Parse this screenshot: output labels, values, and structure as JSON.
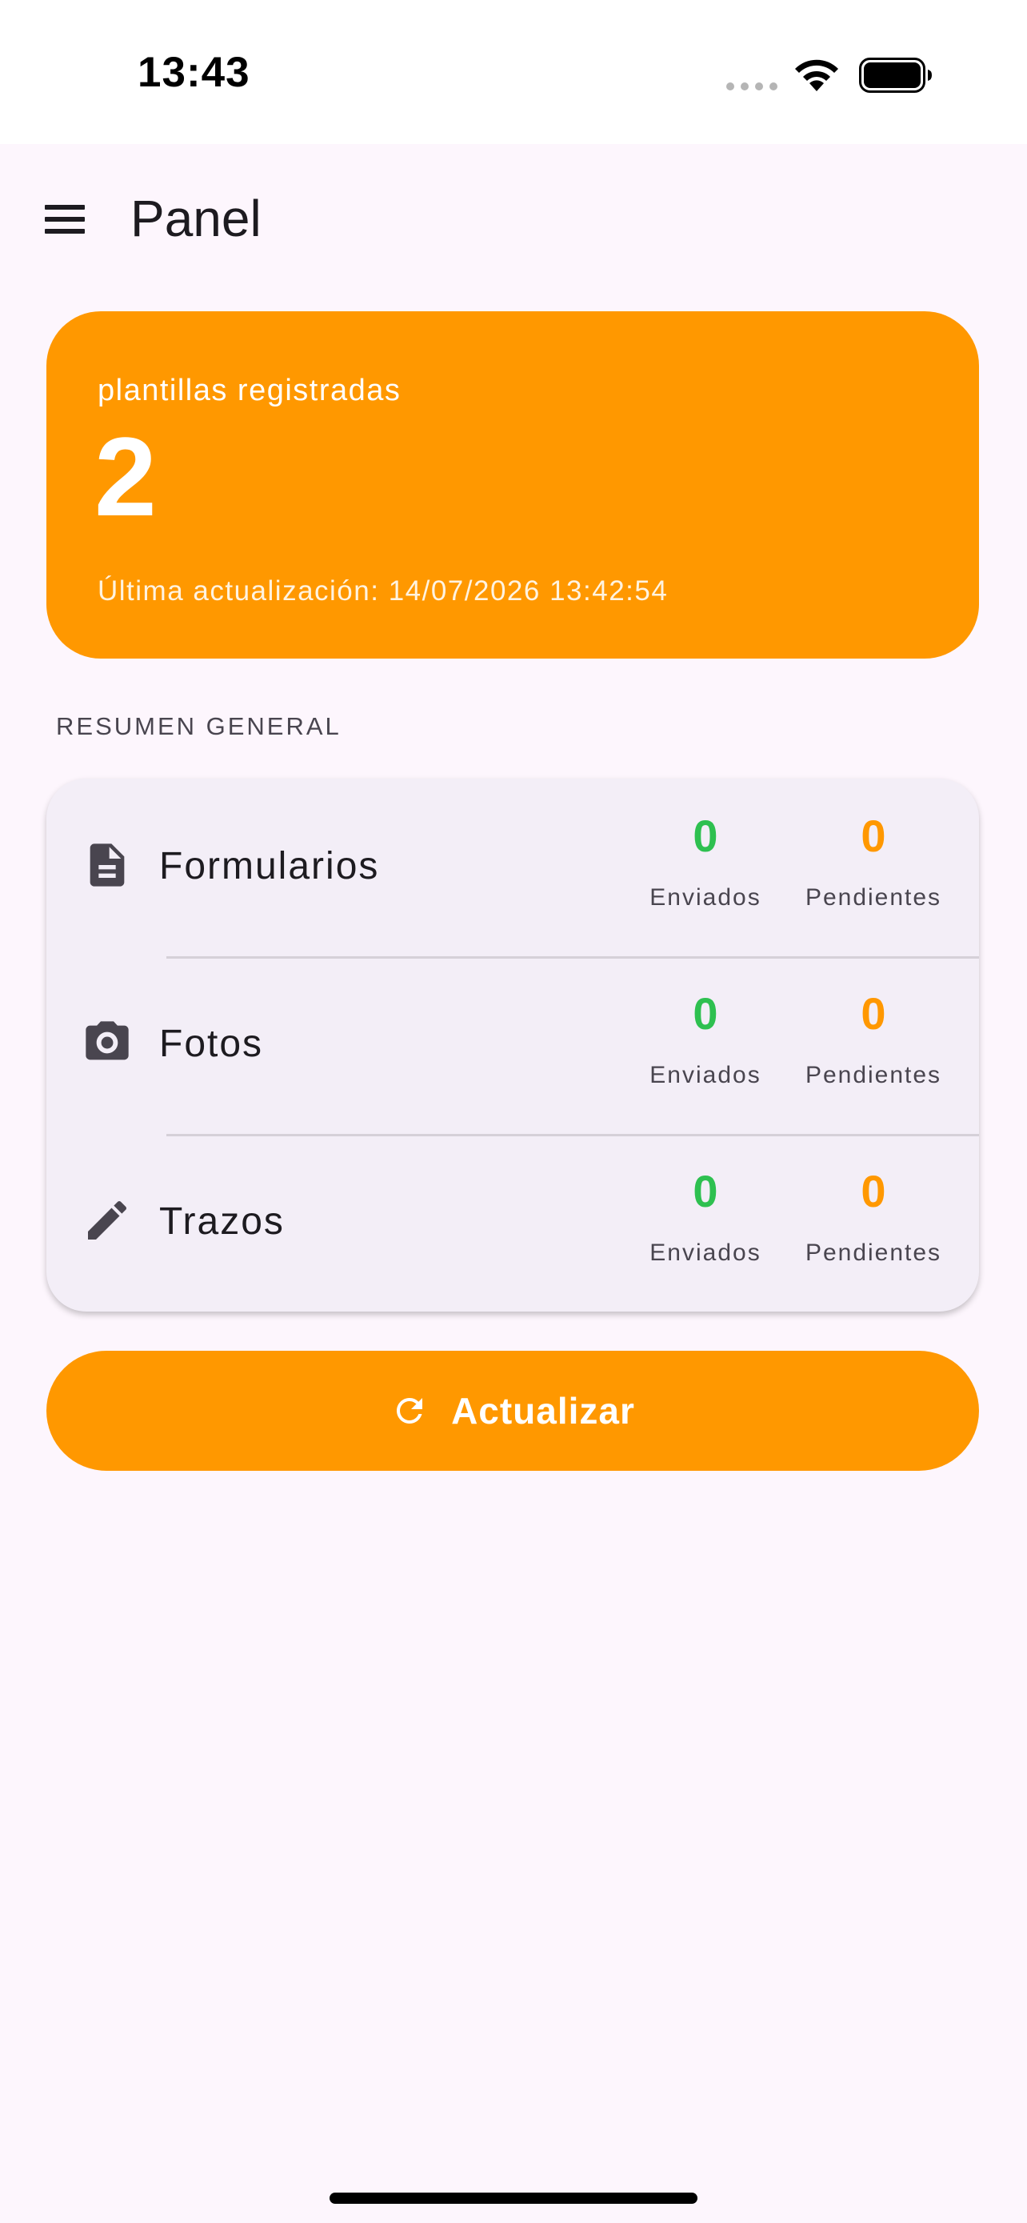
{
  "status_bar": {
    "time": "13:43",
    "icons": [
      "signal-icon",
      "wifi-icon",
      "battery-icon"
    ]
  },
  "app_bar": {
    "menu_icon": "menu-icon",
    "title": "Panel"
  },
  "hero": {
    "caption": "plantillas registradas",
    "count": "2",
    "updated": "Última actualización: 14/07/2026 13:42:54",
    "color": "#ff9800"
  },
  "summary": {
    "section_title": "RESUMEN GENERAL",
    "rows": [
      {
        "icon": "document-icon",
        "label": "Formularios",
        "sent_value": "0",
        "sent_label": "Enviados",
        "pending_value": "0",
        "pending_label": "Pendientes"
      },
      {
        "icon": "camera-icon",
        "label": "Fotos",
        "sent_value": "0",
        "sent_label": "Enviados",
        "pending_value": "0",
        "pending_label": "Pendientes"
      },
      {
        "icon": "pencil-icon",
        "label": "Trazos",
        "sent_value": "0",
        "sent_label": "Enviados",
        "pending_value": "0",
        "pending_label": "Pendientes"
      }
    ],
    "sent_color": "#2ec050",
    "pending_color": "#ff9800"
  },
  "refresh_button": {
    "icon": "refresh-icon",
    "label": "Actualizar"
  }
}
